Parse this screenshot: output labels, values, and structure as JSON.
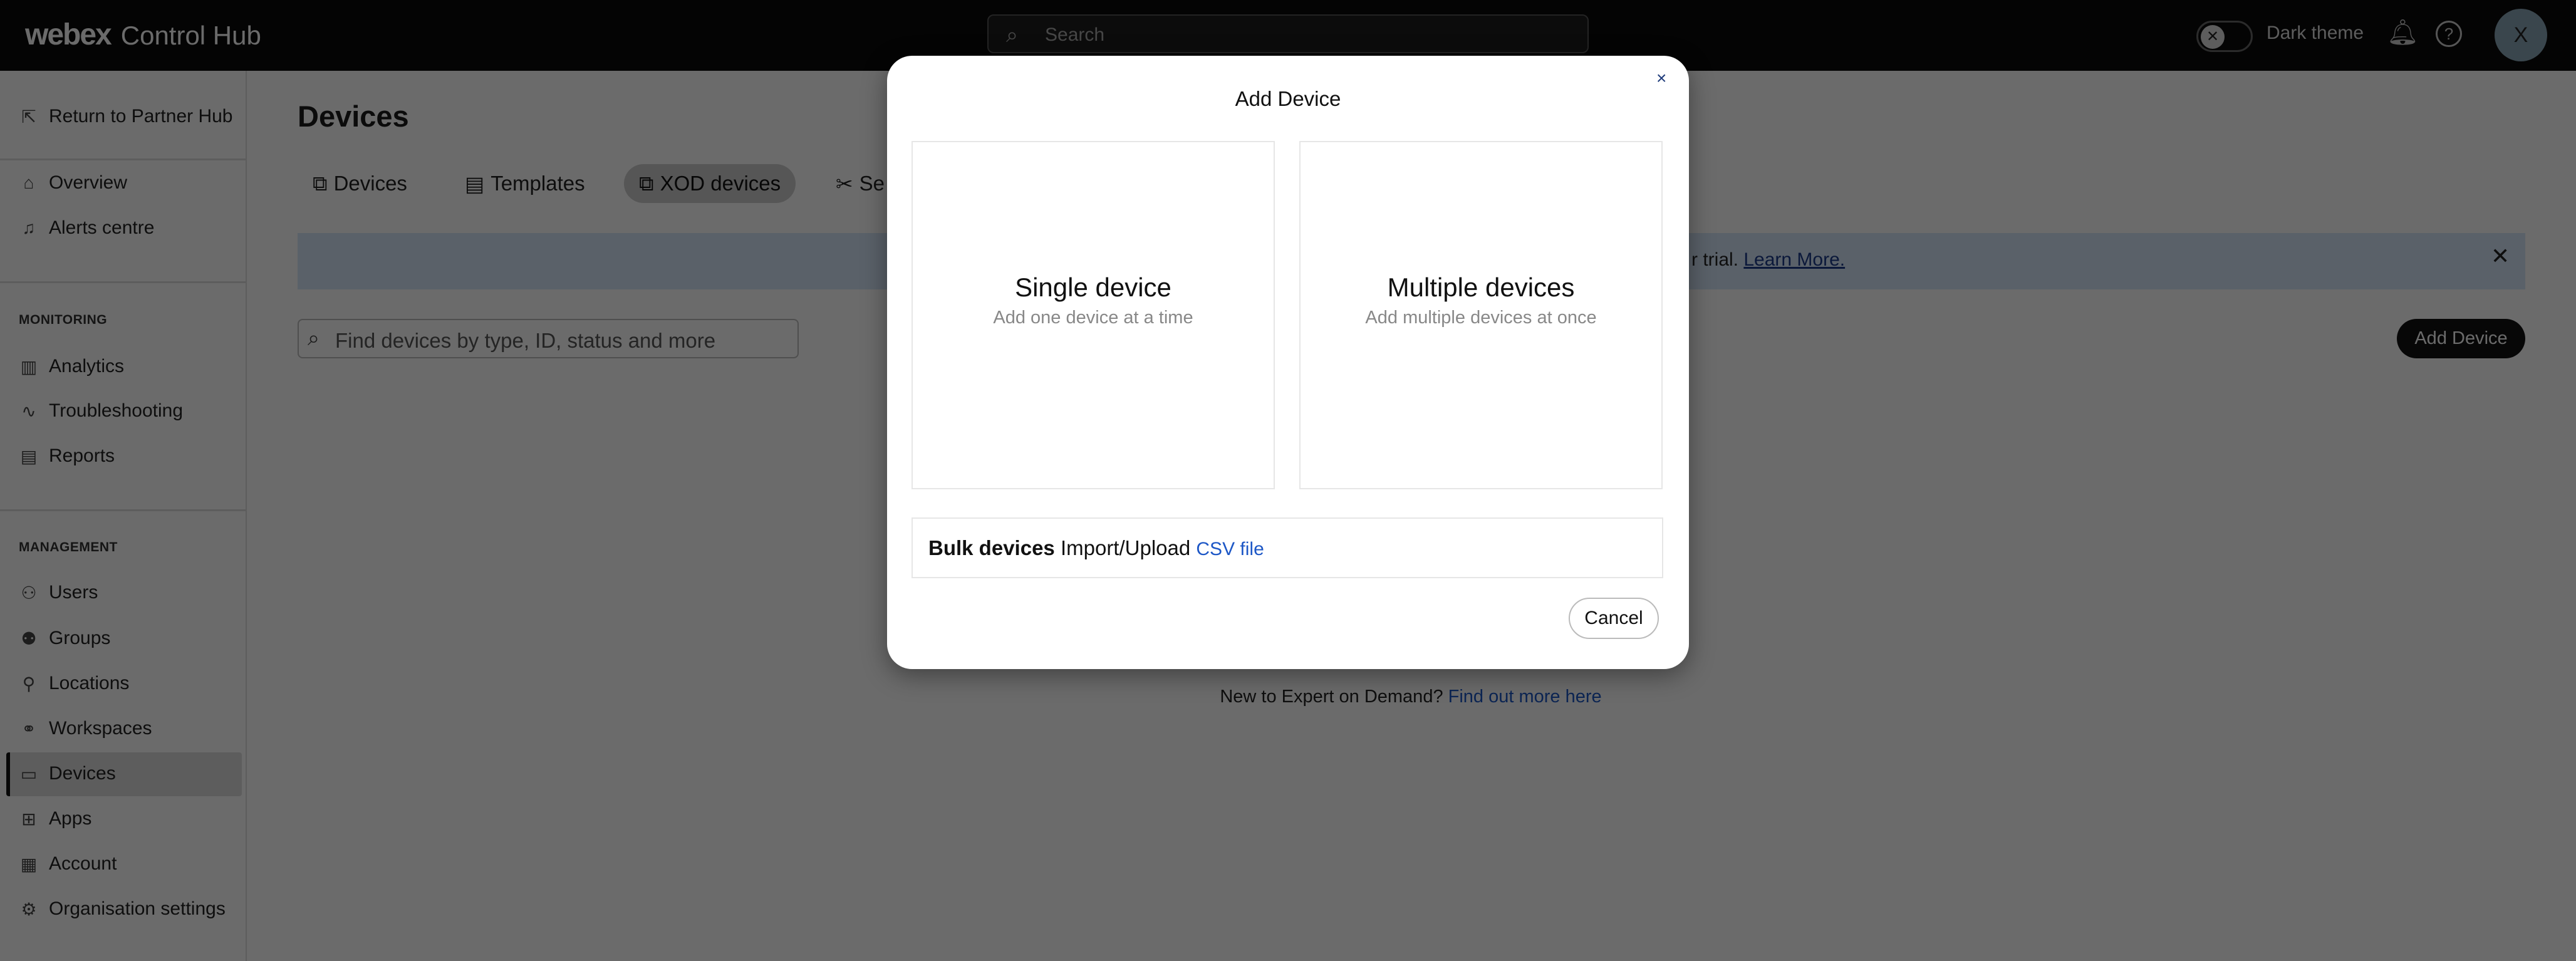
{
  "topbar": {
    "brand": "webex",
    "product": "Control Hub",
    "search_placeholder": "Search",
    "dark_theme_label": "Dark theme",
    "avatar_initial": "X"
  },
  "sidebar": {
    "return_label": "Return to Partner Hub",
    "items_top": [
      {
        "label": "Overview",
        "icon": "home-icon"
      },
      {
        "label": "Alerts centre",
        "icon": "bell-icon"
      }
    ],
    "monitoring_heading": "MONITORING",
    "monitoring": [
      {
        "label": "Analytics"
      },
      {
        "label": "Troubleshooting"
      },
      {
        "label": "Reports"
      }
    ],
    "management_heading": "MANAGEMENT",
    "management": [
      {
        "label": "Users"
      },
      {
        "label": "Groups"
      },
      {
        "label": "Locations"
      },
      {
        "label": "Workspaces"
      },
      {
        "label": "Devices",
        "selected": true
      },
      {
        "label": "Apps"
      },
      {
        "label": "Account"
      },
      {
        "label": "Organisation settings"
      }
    ]
  },
  "main": {
    "title": "Devices",
    "tabs": [
      {
        "label": "Devices"
      },
      {
        "label": "Templates"
      },
      {
        "label": "XOD devices",
        "active": true
      },
      {
        "label": "Se"
      }
    ],
    "banner_text": "r trial.",
    "banner_link": "Learn More.",
    "search_placeholder": "Find devices by type, ID, status and more",
    "add_device_label": "Add Device",
    "eod_text": "New to Expert on Demand?",
    "eod_link": "Find out more here"
  },
  "modal": {
    "title": "Add Device",
    "close": "×",
    "single_title": "Single device",
    "single_sub": "Add one device at a time",
    "multi_title": "Multiple devices",
    "multi_sub": "Add multiple devices at once",
    "bulk_bold": "Bulk devices",
    "bulk_text": "Import/Upload",
    "bulk_link": "CSV file",
    "cancel": "Cancel"
  }
}
